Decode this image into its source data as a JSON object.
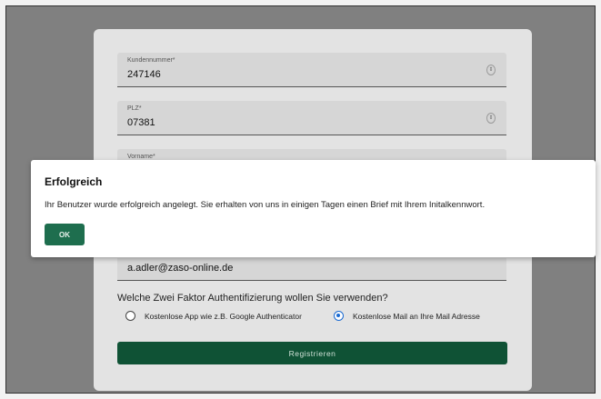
{
  "form": {
    "fields": [
      {
        "label": "Kundennummer*",
        "value": "247146"
      },
      {
        "label": "PLZ*",
        "value": "07381"
      },
      {
        "label": "Vorname*",
        "value": ""
      }
    ],
    "email_value": "a.adler@zaso-online.de",
    "two_factor_question": "Welche Zwei Faktor Authentifizierung wollen Sie verwenden?",
    "two_factor_options": [
      {
        "label": "Kostenlose App wie z.B. Google Authenticator",
        "selected": false
      },
      {
        "label": "Kostenlose Mail an Ihre Mail Adresse",
        "selected": true
      }
    ],
    "register_label": "Registrieren"
  },
  "dialog": {
    "title": "Erfolgreich",
    "message": "Ihr Benutzer wurde erfolgreich angelegt. Sie erhalten von uns in einigen Tagen einen Brief mit Ihrem Initalkennwort.",
    "ok_label": "OK"
  },
  "colors": {
    "overlay": "#808080",
    "primary_button": "#0f5235",
    "ok_button": "#1e6e4e",
    "radio_selected": "#1a6ad2"
  }
}
